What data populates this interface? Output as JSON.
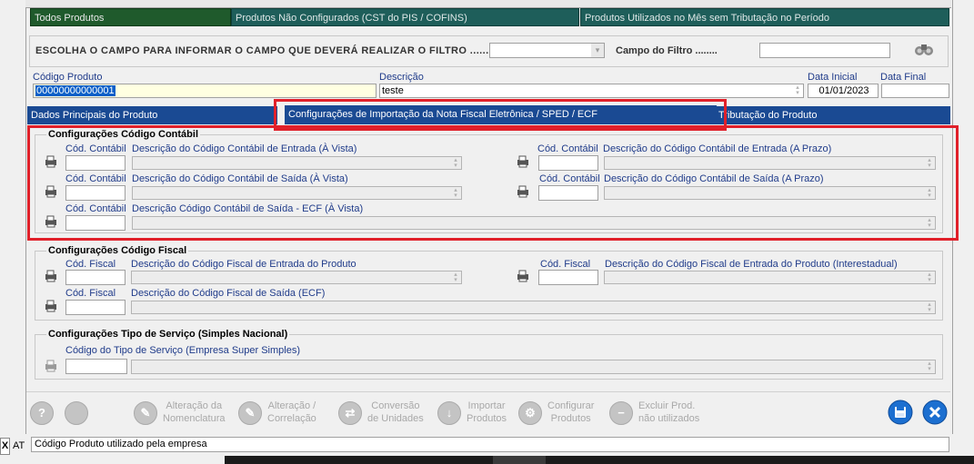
{
  "top_tabs": {
    "todos": "Todos Produtos",
    "nao_configurados": "Produtos Não Configurados (CST do PIS / COFINS)",
    "sem_tributacao": "Produtos Utilizados no Mês sem Tributação no Período"
  },
  "filter": {
    "prompt": "ESCOLHA O CAMPO PARA INFORMAR O CAMPO QUE DEVERÁ REALIZAR O FILTRO .........:",
    "campo_label": "Campo do Filtro ........",
    "campo_value": ""
  },
  "header": {
    "codigo_label": "Código Produto",
    "codigo_value": "00000000000001",
    "descricao_label": "Descrição",
    "descricao_value": "teste",
    "data_inicial_label": "Data Inicial",
    "data_inicial_value": "01/01/2023",
    "data_final_label": "Data Final",
    "data_final_value": ""
  },
  "tabs": {
    "dados": "Dados Principais do Produto",
    "importacao": "Configurações de Importação da Nota Fiscal Eletrônica / SPED / ECF",
    "tributacao": "Tributação do Produto"
  },
  "contabil": {
    "title": "Configurações Código Contábil",
    "cod_label": "Cód. Contábil",
    "entrada_vista": "Descrição do Código Contábil de Entrada (À Vista)",
    "entrada_prazo": "Descrição do Código Contábil de Entrada (A Prazo)",
    "saida_vista": "Descrição do Código Contábil de Saída (À Vista)",
    "saida_prazo": "Descrição do Código Contábil de Saída (A Prazo)",
    "saida_ecf": "Descrição Código Contábil de Saída  - ECF (À Vista)"
  },
  "fiscal": {
    "title": "Configurações Código Fiscal",
    "cod_label": "Cód. Fiscal",
    "entrada": "Descrição do Código Fiscal de Entrada do Produto",
    "entrada_inter": "Descrição do Código Fiscal de Entrada do Produto (Interestadual)",
    "saida_ecf": "Descrição do Código Fiscal de Saída (ECF)"
  },
  "servico": {
    "title": "Configurações Tipo de Serviço (Simples Nacional)",
    "codigo_label": "Código do Tipo de Serviço (Empresa Super Simples)"
  },
  "toolbar": {
    "alteracao_nomenclatura": [
      "Alteração da",
      "Nomenclatura"
    ],
    "alteracao_correlacao": [
      "Alteração /",
      "Correlação"
    ],
    "conversao": [
      "Conversão",
      "de Unidades"
    ],
    "importar": [
      "Importar",
      "Produtos"
    ],
    "configurar": [
      "Configurar",
      "Produtos"
    ],
    "excluir": [
      "Excluir Prod.",
      "não utilizados"
    ]
  },
  "status": {
    "text": "Código Produto utilizado pela empresa",
    "left_button": "X",
    "left_label": "AT"
  },
  "colors": {
    "tab_blue": "#1a4a93",
    "top_green": "#1f5a2c",
    "top_teal": "#1e5e5a",
    "highlight": "#e0202a",
    "code_yellow": "#ffffe1"
  }
}
